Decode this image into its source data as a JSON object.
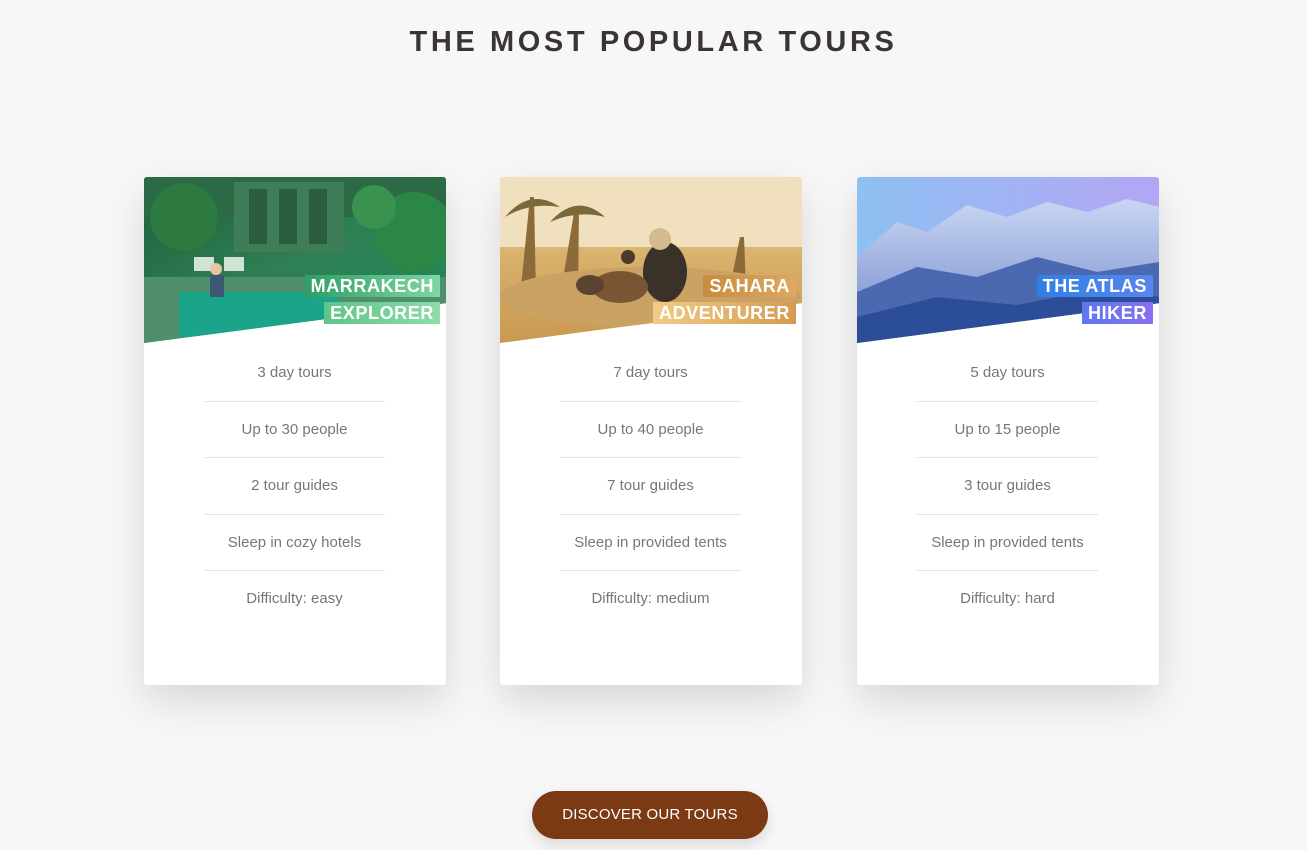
{
  "section": {
    "title": "THE MOST POPULAR TOURS"
  },
  "cards": [
    {
      "title_line1": "MARRAKECH",
      "title_line2": "EXPLORER",
      "color_from": "#2f9e63",
      "color_to": "#7ed7a0",
      "image": "riad-courtyard-pool",
      "details": [
        "3 day tours",
        "Up to 30 people",
        "2 tour guides",
        "Sleep in cozy hotels",
        "Difficulty: easy"
      ]
    },
    {
      "title_line1": "SAHARA",
      "title_line2": "ADVENTURER",
      "color_from": "#c98b3c",
      "color_to": "#f1cc86",
      "image": "desert-camel-caravan",
      "details": [
        "7 day tours",
        "Up to 40 people",
        "7 tour guides",
        "Sleep in provided tents",
        "Difficulty: medium"
      ]
    },
    {
      "title_line1": "THE ATLAS",
      "title_line2": "HIKER",
      "color_from": "#2f7fe6",
      "color_to": "#8a7bf0",
      "image": "snowy-atlas-mountains",
      "details": [
        "5 day tours",
        "Up to 15 people",
        "3 tour guides",
        "Sleep in provided tents",
        "Difficulty: hard"
      ]
    }
  ],
  "cta": {
    "label": "DISCOVER OUR TOURS",
    "color": "#7b3a14"
  }
}
